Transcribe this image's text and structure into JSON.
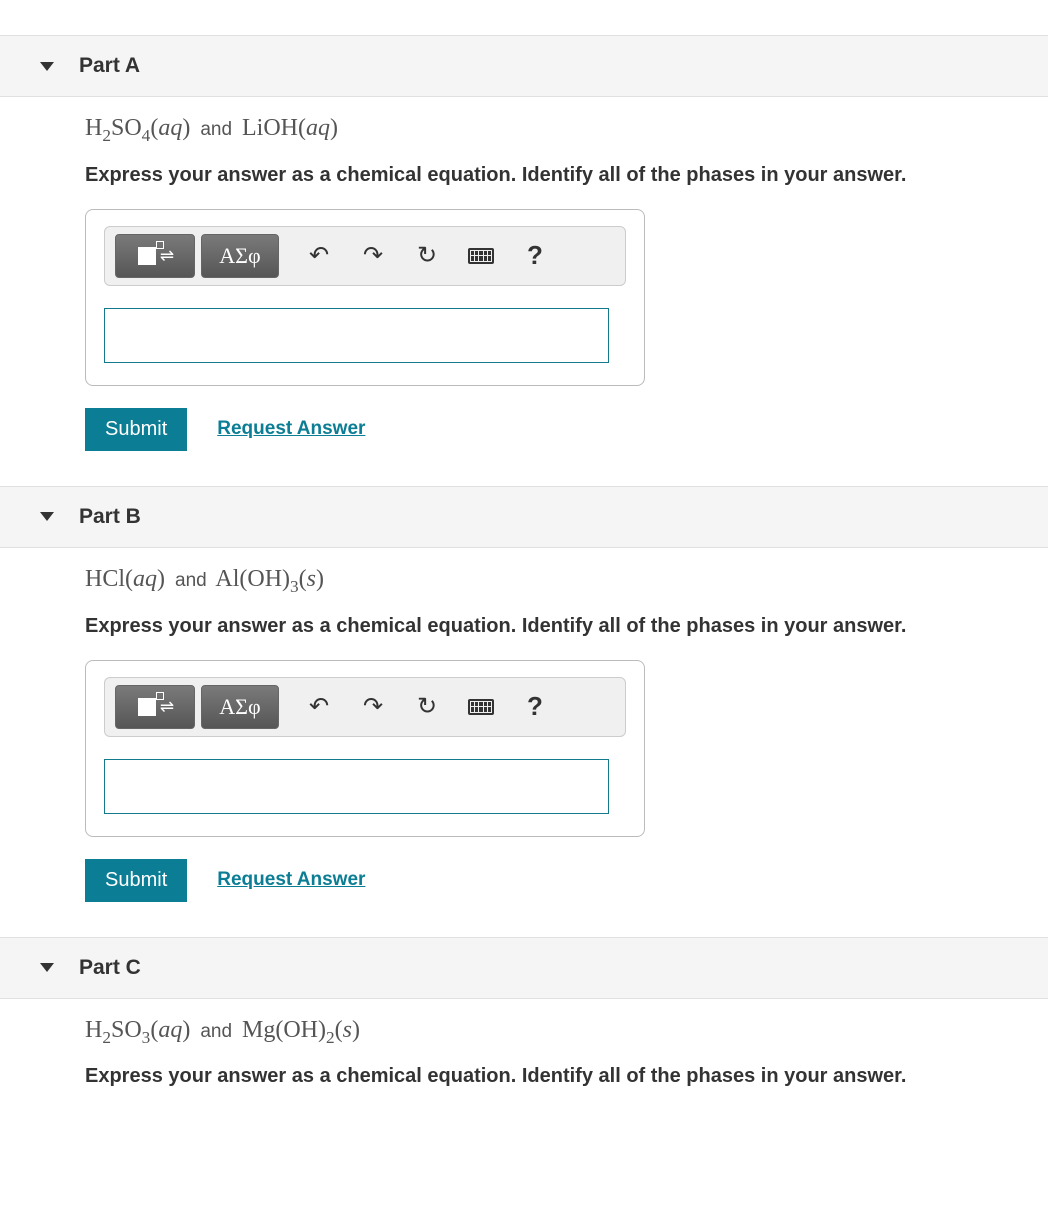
{
  "toolbar": {
    "greek_label": "ΑΣφ",
    "help_label": "?"
  },
  "actions": {
    "submit_label": "Submit",
    "request_label": "Request Answer"
  },
  "instruction_text": "Express your answer as a chemical equation. Identify all of the phases in your answer.",
  "parts": {
    "a": {
      "title": "Part A",
      "formula_html": "H<sub>2</sub>SO<sub>4</sub>(<span class='it'>aq</span>) <span class='and'>and</span> LiOH(<span class='it'>aq</span>)"
    },
    "b": {
      "title": "Part B",
      "formula_html": "HCl(<span class='it'>aq</span>) <span class='and'>and</span> Al(OH)<sub>3</sub>(<span class='it'>s</span>)"
    },
    "c": {
      "title": "Part C",
      "formula_html": "H<sub>2</sub>SO<sub>3</sub>(<span class='it'>aq</span>) <span class='and'>and</span> Mg(OH)<sub>2</sub>(<span class='it'>s</span>)"
    }
  }
}
